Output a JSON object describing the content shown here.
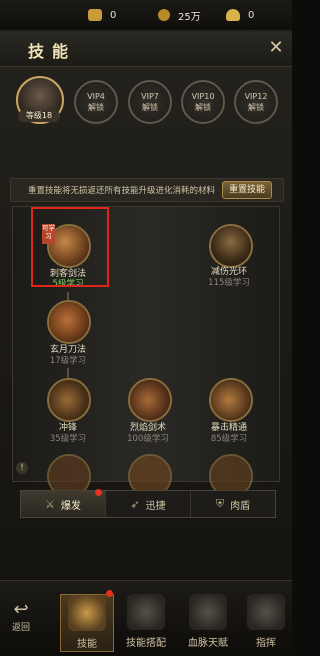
{
  "currency": {
    "gold": "0",
    "silver": "25万",
    "ingot": "0"
  },
  "panel": {
    "title": "技能",
    "close": "✕"
  },
  "player": {
    "level": "等级18"
  },
  "vip": [
    {
      "name": "VIP4",
      "status": "解锁"
    },
    {
      "name": "VIP7",
      "status": "解锁"
    },
    {
      "name": "VIP10",
      "status": "解锁"
    },
    {
      "name": "VIP12",
      "status": "解锁"
    }
  ],
  "reset": {
    "text": "重置技能将无损返还所有技能升级进化消耗的材料",
    "button": "重置技能"
  },
  "skills": [
    {
      "name": "刺客剑法",
      "req": "5级学习",
      "tag": "可学习"
    },
    {
      "name": "减伤光环",
      "req": "115级学习"
    },
    {
      "name": "玄月刀法",
      "req": "17级学习"
    },
    {
      "name": "冲锋",
      "req": "35级学习"
    },
    {
      "name": "烈焰剑术",
      "req": "100级学习"
    },
    {
      "name": "暴击精通",
      "req": "85级学习"
    }
  ],
  "tabs": [
    {
      "label": "爆发"
    },
    {
      "label": "迅捷"
    },
    {
      "label": "肉盾"
    }
  ],
  "bottom_nav": {
    "back": "返回",
    "items": [
      {
        "label": "技能"
      },
      {
        "label": "技能搭配"
      },
      {
        "label": "血脉天赋"
      },
      {
        "label": "指挥"
      }
    ]
  },
  "colors": {
    "accent": "#c9a760",
    "highlight": "#e0261b",
    "learnable": "#7cd35e"
  }
}
